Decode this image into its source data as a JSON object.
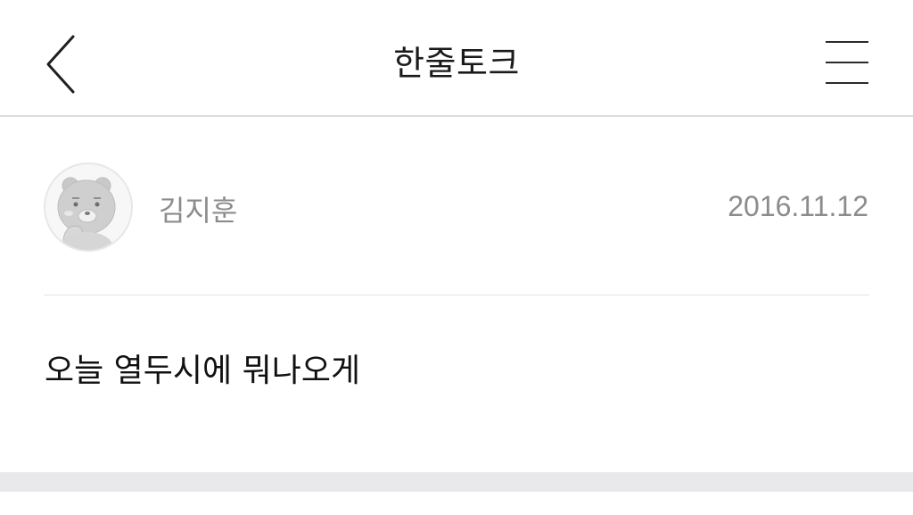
{
  "header": {
    "title": "한줄토크",
    "back_icon": "chevron-left-icon",
    "menu_icon": "hamburger-menu-icon"
  },
  "post": {
    "author": "김지훈",
    "date": "2016.11.12",
    "body": "오늘 열두시에 뭐나오게",
    "avatar_icon": "character-avatar-icon"
  },
  "colors": {
    "title_text": "#1a1a1a",
    "meta_text": "#8c8c8c",
    "body_text": "#111111",
    "divider": "#e2e2e2",
    "bottom_bar": "#e9e9ec"
  }
}
